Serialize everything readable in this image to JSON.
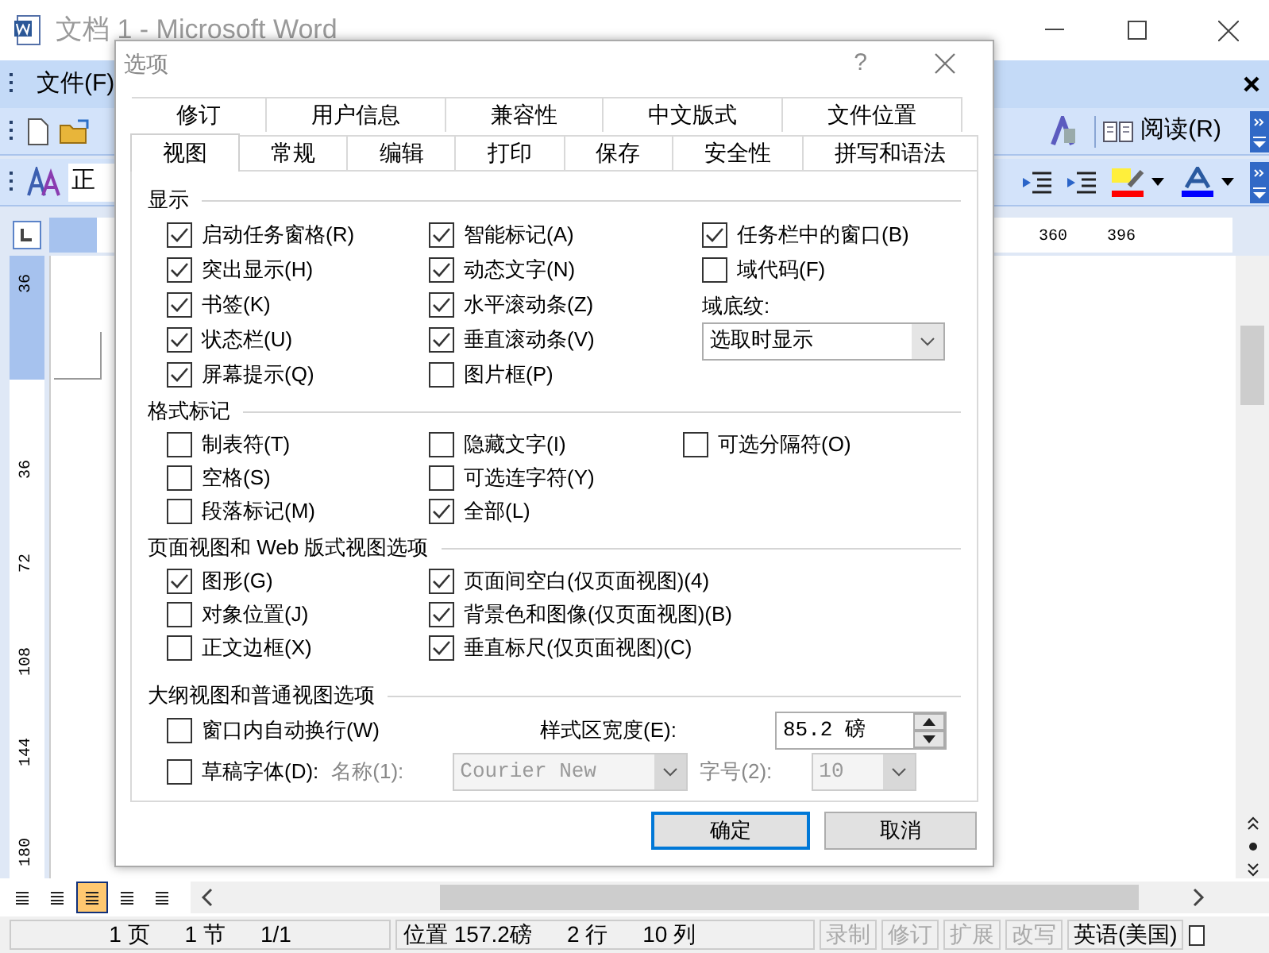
{
  "window": {
    "title": "文档 1 - Microsoft Word"
  },
  "menu": [
    {
      "label": "文件(F)"
    }
  ],
  "toolbar": {
    "reading_button": "阅读(R)",
    "style_box": "正"
  },
  "ruler": {
    "labels": [
      "360",
      "396"
    ]
  },
  "vertical_ruler": {
    "labels": [
      "36",
      "36",
      "72",
      "108",
      "144",
      "180"
    ]
  },
  "view_buttons": [
    {
      "selected": false
    },
    {
      "selected": false
    },
    {
      "selected": true
    },
    {
      "selected": false
    },
    {
      "selected": false
    }
  ],
  "dialog": {
    "title": "选项",
    "help": "?",
    "tab_rows": [
      [
        {
          "label": "修订",
          "selected": false
        },
        {
          "label": "用户信息",
          "selected": false
        },
        {
          "label": "兼容性",
          "selected": false
        },
        {
          "label": "中文版式",
          "selected": false
        },
        {
          "label": "文件位置",
          "selected": false
        }
      ],
      [
        {
          "label": "视图",
          "selected": true
        },
        {
          "label": "常规",
          "selected": false
        },
        {
          "label": "编辑",
          "selected": false
        },
        {
          "label": "打印",
          "selected": false
        },
        {
          "label": "保存",
          "selected": false
        },
        {
          "label": "安全性",
          "selected": false
        },
        {
          "label": "拼写和语法",
          "selected": false
        }
      ]
    ],
    "display": {
      "title": "显示",
      "columns": [
        [
          {
            "label": "启动任务窗格(R)",
            "checked": true
          },
          {
            "label": "突出显示(H)",
            "checked": true
          },
          {
            "label": "书签(K)",
            "checked": true
          },
          {
            "label": "状态栏(U)",
            "checked": true
          },
          {
            "label": "屏幕提示(Q)",
            "checked": true
          }
        ],
        [
          {
            "label": "智能标记(A)",
            "checked": true
          },
          {
            "label": "动态文字(N)",
            "checked": true
          },
          {
            "label": "水平滚动条(Z)",
            "checked": true
          },
          {
            "label": "垂直滚动条(V)",
            "checked": true
          },
          {
            "label": "图片框(P)",
            "checked": false
          }
        ],
        [
          {
            "label": "任务栏中的窗口(B)",
            "checked": true
          },
          {
            "label": "域代码(F)",
            "checked": false
          }
        ]
      ],
      "shading": {
        "label": "域底纹:",
        "value": "选取时显示"
      }
    },
    "format_marks": {
      "title": "格式标记",
      "columns": [
        [
          {
            "label": "制表符(T)",
            "checked": false
          },
          {
            "label": "空格(S)",
            "checked": false
          },
          {
            "label": "段落标记(M)",
            "checked": false
          }
        ],
        [
          {
            "label": "隐藏文字(I)",
            "checked": false
          },
          {
            "label": "可选连字符(Y)",
            "checked": false
          },
          {
            "label": "全部(L)",
            "checked": true
          }
        ],
        [
          {
            "label": "可选分隔符(O)",
            "checked": false
          }
        ]
      ]
    },
    "page_view": {
      "title": "页面视图和 Web 版式视图选项",
      "columns": [
        [
          {
            "label": "图形(G)",
            "checked": true
          },
          {
            "label": "对象位置(J)",
            "checked": false
          },
          {
            "label": "正文边框(X)",
            "checked": false
          }
        ],
        [
          {
            "label": "页面间空白(仅页面视图)(4)",
            "checked": true
          },
          {
            "label": "背景色和图像(仅页面视图)(B)",
            "checked": true
          },
          {
            "label": "垂直标尺(仅页面视图)(C)",
            "checked": true
          }
        ]
      ]
    },
    "outline": {
      "title": "大纲视图和普通视图选项",
      "wrap": {
        "label": "窗口内自动换行(W)",
        "checked": false
      },
      "style_width": {
        "label": "样式区宽度(E):",
        "value": "85.2 磅"
      },
      "draft": {
        "label": "草稿字体(D):",
        "checked": false
      },
      "font_name": {
        "label": "名称(1):",
        "value": "Courier New",
        "disabled": true
      },
      "font_size": {
        "label": "字号(2):",
        "value": "10",
        "disabled": true
      }
    },
    "buttons": [
      {
        "label": "确定",
        "default": true
      },
      {
        "label": "取消",
        "default": false
      }
    ]
  },
  "status_bar": [
    {
      "items": [
        {
          "text": "1 页",
          "disabled": false
        },
        {
          "text": "1 节",
          "disabled": false
        },
        {
          "text": "1/1",
          "disabled": false
        }
      ]
    },
    {
      "items": [
        {
          "text": "位置 157.2磅",
          "disabled": false
        },
        {
          "text": "2 行",
          "disabled": false
        },
        {
          "text": "10 列",
          "disabled": false
        }
      ]
    },
    {
      "items": [
        {
          "text": "录制",
          "disabled": true
        }
      ]
    },
    {
      "items": [
        {
          "text": "修订",
          "disabled": true
        }
      ]
    },
    {
      "items": [
        {
          "text": "扩展",
          "disabled": true
        }
      ]
    },
    {
      "items": [
        {
          "text": "改写",
          "disabled": true
        }
      ]
    },
    {
      "items": [
        {
          "text": "英语(美国)",
          "disabled": false
        }
      ]
    }
  ]
}
